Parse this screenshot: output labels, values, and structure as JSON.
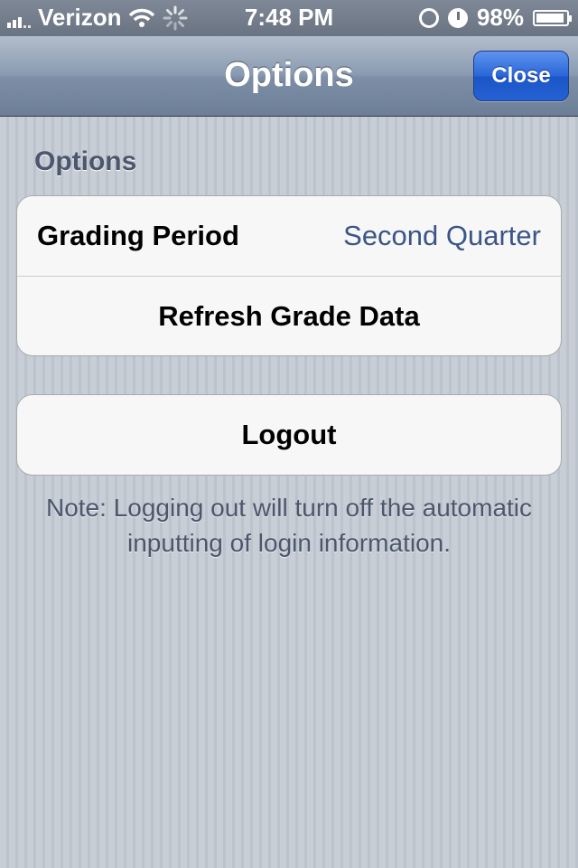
{
  "status_bar": {
    "carrier": "Verizon",
    "time": "7:48 PM",
    "battery_percent": "98%",
    "icons": [
      "signal-icon",
      "wifi-icon",
      "activity-spinner-icon",
      "rotation-lock-icon",
      "alarm-icon",
      "battery-icon"
    ]
  },
  "nav_bar": {
    "title": "Options",
    "close_label": "Close",
    "close_color": "#2a66d8"
  },
  "section": {
    "header": "Options",
    "rows": [
      {
        "label": "Grading Period",
        "value": "Second Quarter"
      },
      {
        "label": "Refresh Grade Data"
      }
    ]
  },
  "logout": {
    "label": "Logout",
    "note": "Note: Logging out will turn off the automatic inputting of login information."
  },
  "colors": {
    "value_text": "#3a5587",
    "section_header": "#4c566c",
    "background": "#c5ccd4"
  }
}
